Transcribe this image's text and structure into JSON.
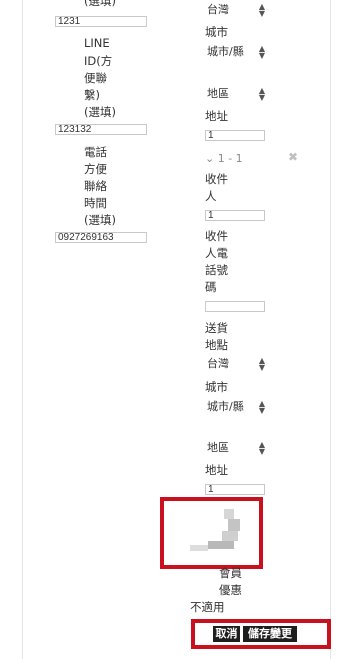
{
  "left_column": {
    "optional_cut": "(選填)",
    "input_1_value": "1231",
    "line_label_lines": [
      "LINE",
      "ID(方",
      "便聯",
      "繫)",
      "(選填)"
    ],
    "line_input_value": "123132",
    "phone_time_label_lines": [
      "電話",
      "方便",
      "聯絡",
      "時間",
      "(選填)"
    ],
    "phone_input_value": "0927269163"
  },
  "right_column": {
    "country_select_top": "台灣",
    "city_label": "城市",
    "city_select_top": "城市/縣",
    "district_select_top": "地區",
    "address_label_top": "地址",
    "address_input_top": "1",
    "collapse_label": "⌄ 1 - 1",
    "remove_icon": "✖",
    "recipient_label_lines": [
      "收件",
      "人"
    ],
    "recipient_input": "1",
    "recipient_phone_label_lines": [
      "收件",
      "人電",
      "話號",
      "碼"
    ],
    "recipient_phone_input": "",
    "delivery_label_lines": [
      "送貨",
      "地點"
    ],
    "country_select_bottom": "台灣",
    "city_label_bottom": "城市",
    "city_select_bottom": "城市/縣",
    "district_select_bottom": "地區",
    "address_label_bottom": "地址",
    "address_input_bottom": "1",
    "member_discount_lines": [
      "會員",
      "優惠"
    ],
    "not_applicable": "不適用"
  },
  "footer": {
    "cancel_label": "取消",
    "save_label": "儲存變更"
  },
  "colors": {
    "highlight_red": "#c8101e",
    "button_dark": "#1e1e1e",
    "border_gray": "#c9c9c9"
  }
}
